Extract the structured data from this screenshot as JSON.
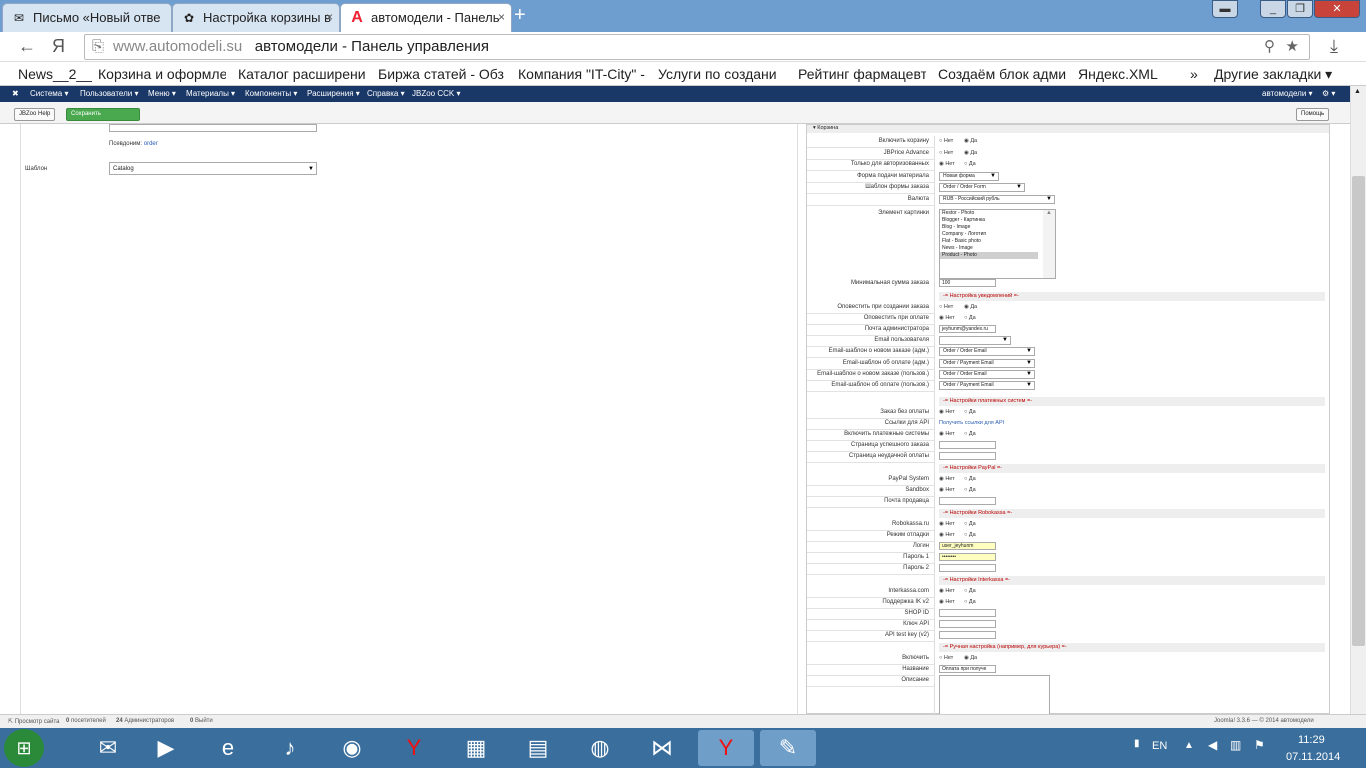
{
  "tabs": [
    {
      "label": "Письмо «Новый отве"
    },
    {
      "label": "Настройка корзины в"
    },
    {
      "label": "автомодели - Панель"
    }
  ],
  "address": {
    "domain": "www.automodeli.su",
    "title": "автомодели - Панель управления"
  },
  "bookmarks": [
    "News__2__",
    "Корзина и оформле",
    "Каталог расширени",
    "Биржа статей - Обз",
    "Компания \"IT-City\" -",
    "Услуги по создани",
    "Рейтинг фармацевт",
    "Создаём блок адми",
    "Яндекс.XML",
    "Другие закладки ▾"
  ],
  "joomla_nav": [
    "Система ▾",
    "Пользователи ▾",
    "Меню ▾",
    "Материалы ▾",
    "Компоненты ▾",
    "Расширения ▾",
    "Справка ▾",
    "JBZoo CCK ▾"
  ],
  "joomla_site": "автомодели ▾",
  "toolbar": {
    "help": "JBZoo Help",
    "save": "Сохранить",
    "helpright": "Помощь"
  },
  "left": {
    "subtitle": "Псевдоним:",
    "order": "order",
    "template_label": "Шаблон",
    "template_value": "Catalog"
  },
  "right": {
    "panel_title": "Корзина",
    "rows": [
      {
        "label": "Включить корзину",
        "type": "radio",
        "yes": true
      },
      {
        "label": "JBPrice Advance",
        "type": "radio",
        "yes": true
      },
      {
        "label": "Только для авторизованных",
        "type": "radio",
        "yes": false
      },
      {
        "label": "Форма подачи материала",
        "type": "select",
        "value": "Новая форма"
      },
      {
        "label": "Шаблон формы заказа",
        "type": "select",
        "value": "Order / Order Form"
      },
      {
        "label": "Валюта",
        "type": "select",
        "value": "RUB - Российский рубль"
      }
    ],
    "image_label": "Элемент картинки",
    "image_options": [
      "Restor - Photo",
      "Blogger - Картинка",
      "Blog - Image",
      "Company - Логотип",
      "Flat - Basic photo",
      "News - Image",
      "Product - Photo"
    ],
    "min_label": "Минимальная сумма заказа",
    "min_value": "100",
    "sections": [
      "-= Настройка уведомлений =-",
      "-= Настройки платежных систем =-",
      "-= Настройки PayPal =-",
      "-= Настройки Robokassa =-",
      "-= Настройки Interkassa =-",
      "-= Ручная настройка (например, для курьера) =-"
    ],
    "notify": [
      {
        "label": "Оповестить при создании заказа",
        "type": "radio",
        "yes": true
      },
      {
        "label": "Оповестить при оплате",
        "type": "radio",
        "yes": false
      },
      {
        "label": "Почта администратора",
        "type": "input",
        "value": "jeyhunm@yandex.ru"
      },
      {
        "label": "Email пользователя",
        "type": "select",
        "value": ""
      },
      {
        "label": "Email-шаблон о новом заказе (адм.)",
        "type": "select",
        "value": "Order / Order Email"
      },
      {
        "label": "Email-шаблон об оплате (адм.)",
        "type": "select",
        "value": "Order / Payment Email"
      },
      {
        "label": "Email-шаблон о новом заказе (пользов.)",
        "type": "select",
        "value": "Order / Order Email"
      },
      {
        "label": "Email-шаблон об оплате (пользов.)",
        "type": "select",
        "value": "Order / Payment Email"
      }
    ],
    "payment": [
      {
        "label": "Заказ без оплаты",
        "type": "radio",
        "yes": false
      },
      {
        "label": "Ссылки для API",
        "type": "link",
        "value": "Получить ссылки для API"
      },
      {
        "label": "Включить платежные системы",
        "type": "radio",
        "yes": false
      },
      {
        "label": "Страница успешного заказа",
        "type": "input",
        "value": ""
      },
      {
        "label": "Страница неудачной оплаты",
        "type": "input",
        "value": ""
      }
    ],
    "paypal": [
      {
        "label": "PayPal System",
        "type": "radio",
        "yes": false
      },
      {
        "label": "Sandbox",
        "type": "radio",
        "yes": false
      },
      {
        "label": "Почта продавца",
        "type": "input",
        "value": ""
      }
    ],
    "robokassa": [
      {
        "label": "Robokassa.ru",
        "type": "radio",
        "yes": false
      },
      {
        "label": "Режим отладки",
        "type": "radio",
        "yes": false
      },
      {
        "label": "Логин",
        "type": "input",
        "value": "user_jeyhunm",
        "yellow": true
      },
      {
        "label": "Пароль 1",
        "type": "input",
        "value": "••••••••",
        "yellow": true
      },
      {
        "label": "Пароль 2",
        "type": "input",
        "value": ""
      }
    ],
    "interkassa": [
      {
        "label": "Interkassa.com",
        "type": "radio",
        "yes": false
      },
      {
        "label": "Поддержка IK v2",
        "type": "radio",
        "yes": false
      },
      {
        "label": "SHOP ID",
        "type": "input",
        "value": ""
      },
      {
        "label": "Ключ API",
        "type": "input",
        "value": ""
      },
      {
        "label": "API test key (v2)",
        "type": "input",
        "value": ""
      }
    ],
    "manual": [
      {
        "label": "Включить",
        "type": "radio",
        "yes": true
      },
      {
        "label": "Название",
        "type": "input",
        "value": "Оплата при получе"
      },
      {
        "label": "Описание",
        "type": "textarea",
        "value": ""
      }
    ],
    "no": "Нет",
    "yes": "Да"
  },
  "status": {
    "view": "Просмотр сайта",
    "visitors": "посетителей",
    "admins": "Администраторов",
    "exit": "Выйти",
    "v0": "0",
    "v1": "24",
    "v2": "0",
    "joomla": "Joomla! 3.3.6 — © 2014 автомодели"
  },
  "taskbar": {
    "lang": "EN",
    "time": "11:29",
    "date": "07.11.2014"
  }
}
